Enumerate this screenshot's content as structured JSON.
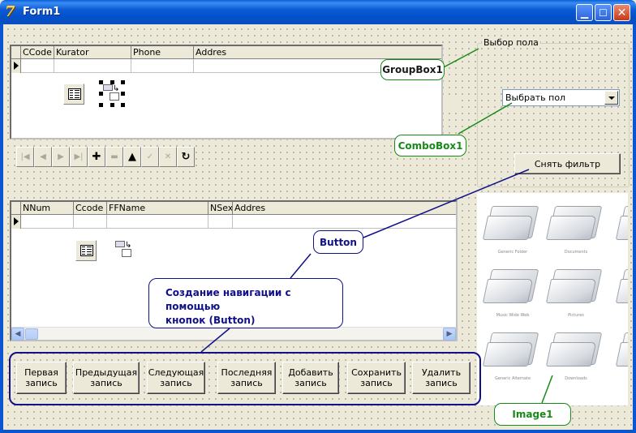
{
  "window": {
    "title": "Form1",
    "app_icon_glyph": "7"
  },
  "grid1": {
    "columns": [
      "CCode",
      "Kurator",
      "Phone",
      "Addres"
    ]
  },
  "grid2": {
    "columns": [
      "NNum",
      "Ccode",
      "FFName",
      "NSex",
      "Addres"
    ]
  },
  "navigator": {
    "buttons": [
      {
        "icon": "first-icon",
        "glyph": "|◀",
        "enabled": false
      },
      {
        "icon": "prior-icon",
        "glyph": "◀",
        "enabled": false
      },
      {
        "icon": "next-icon",
        "glyph": "▶",
        "enabled": false
      },
      {
        "icon": "last-icon",
        "glyph": "▶|",
        "enabled": false
      },
      {
        "icon": "insert-icon",
        "glyph": "✚",
        "enabled": true
      },
      {
        "icon": "delete-icon",
        "glyph": "▬",
        "enabled": false
      },
      {
        "icon": "edit-icon",
        "glyph": "▲",
        "enabled": true
      },
      {
        "icon": "post-icon",
        "glyph": "✓",
        "enabled": false
      },
      {
        "icon": "cancel-icon",
        "glyph": "✕",
        "enabled": false
      },
      {
        "icon": "refresh-icon",
        "glyph": "↻",
        "enabled": true
      }
    ]
  },
  "groupbox": {
    "caption": "Выбор пола",
    "combobox_value": "Выбрать пол",
    "filter_button": "Снять фильтр"
  },
  "record_buttons": [
    {
      "line1": "Первая",
      "line2": "запись"
    },
    {
      "line1": "Предыдущая",
      "line2": "запись"
    },
    {
      "line1": "Следующая",
      "line2": "запись"
    },
    {
      "line1": "Последняя",
      "line2": "запись"
    },
    {
      "line1": "Добавить",
      "line2": "запись"
    },
    {
      "line1": "Сохранить",
      "line2": "запись"
    },
    {
      "line1": "Удалить",
      "line2": "запись"
    }
  ],
  "image": {
    "labels": [
      "Generic Folder",
      "Documents",
      "Music Wide Web",
      "Pictures",
      "Generic Alternate",
      "Downloads"
    ]
  },
  "callouts": {
    "groupbox": "GroupBox1",
    "combobox": "ComboBox1",
    "button": "Button",
    "image": "Image1",
    "navigation_line1": "Создание навигации с помощью",
    "navigation_line2": "кнопок (Button)"
  },
  "colors": {
    "callout_green": "#178a17",
    "callout_blue": "#10108a",
    "titlebar": "#0b5bd6"
  }
}
